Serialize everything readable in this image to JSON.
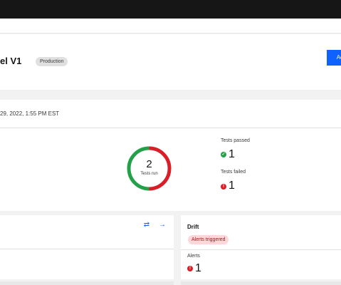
{
  "header": {
    "title": "el V1",
    "badge": "Production",
    "action_label": "Act"
  },
  "run": {
    "date": "29, 2022, 1:55 PM EST",
    "tests_run_count": "2",
    "tests_run_label": "Tests run",
    "passed_label": "Tests passed",
    "passed_count": "1",
    "failed_label": "Tests failed",
    "failed_count": "1",
    "pass_color": "#24a148",
    "fail_color": "#da1e28"
  },
  "drift": {
    "title": "Drift",
    "tag": "Alerts triggered",
    "alerts_label": "Alerts",
    "alerts_count": "1"
  },
  "icons": {
    "swap": "swap-icon",
    "arrow": "arrow-right-icon",
    "check": "checkmark-icon",
    "error": "error-icon"
  }
}
